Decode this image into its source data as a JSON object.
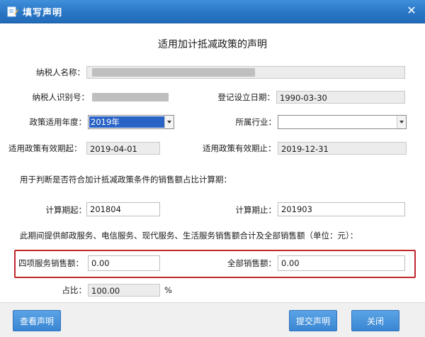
{
  "window": {
    "title": "填写声明",
    "close_icon": "close-icon",
    "title_icon": "edit-icon"
  },
  "form": {
    "heading": "适用加计抵减政策的声明",
    "taxpayer_name": {
      "label": "纳税人名称：",
      "value": ""
    },
    "taxpayer_id": {
      "label": "纳税人识别号：",
      "value": ""
    },
    "register_date": {
      "label": "登记设立日期：",
      "value": "1990-03-30"
    },
    "policy_year": {
      "label": "政策适用年度：",
      "value": "2019年"
    },
    "industry": {
      "label": "所属行业：",
      "value": ""
    },
    "valid_from": {
      "label": "适用政策有效期起：",
      "value": "2019-04-01"
    },
    "valid_to": {
      "label": "适用政策有效期止：",
      "value": "2019-12-31"
    },
    "calc_period_note": "用于判断是否符合加计抵减政策条件的销售额占比计算期：",
    "calc_start": {
      "label": "计算期起：",
      "value": "201804"
    },
    "calc_end": {
      "label": "计算期止：",
      "value": "201903"
    },
    "sales_note": "此期间提供邮政服务、电信服务、现代服务、生活服务销售额合计及全部销售额（单位：元）：",
    "four_service_sales": {
      "label": "四项服务销售额：",
      "value": "0.00"
    },
    "total_sales": {
      "label": "全部销售额：",
      "value": "0.00"
    },
    "ratio": {
      "label": "占比：",
      "value": "100.00",
      "unit": "%"
    }
  },
  "footer": {
    "view_button": "查看声明",
    "submit_button": "提交声明",
    "close_button": "关闭"
  },
  "colors": {
    "titlebar": "#2a77c6",
    "button": "#3a86d2",
    "highlight": "#c1272d",
    "selection": "#2a63c6"
  }
}
